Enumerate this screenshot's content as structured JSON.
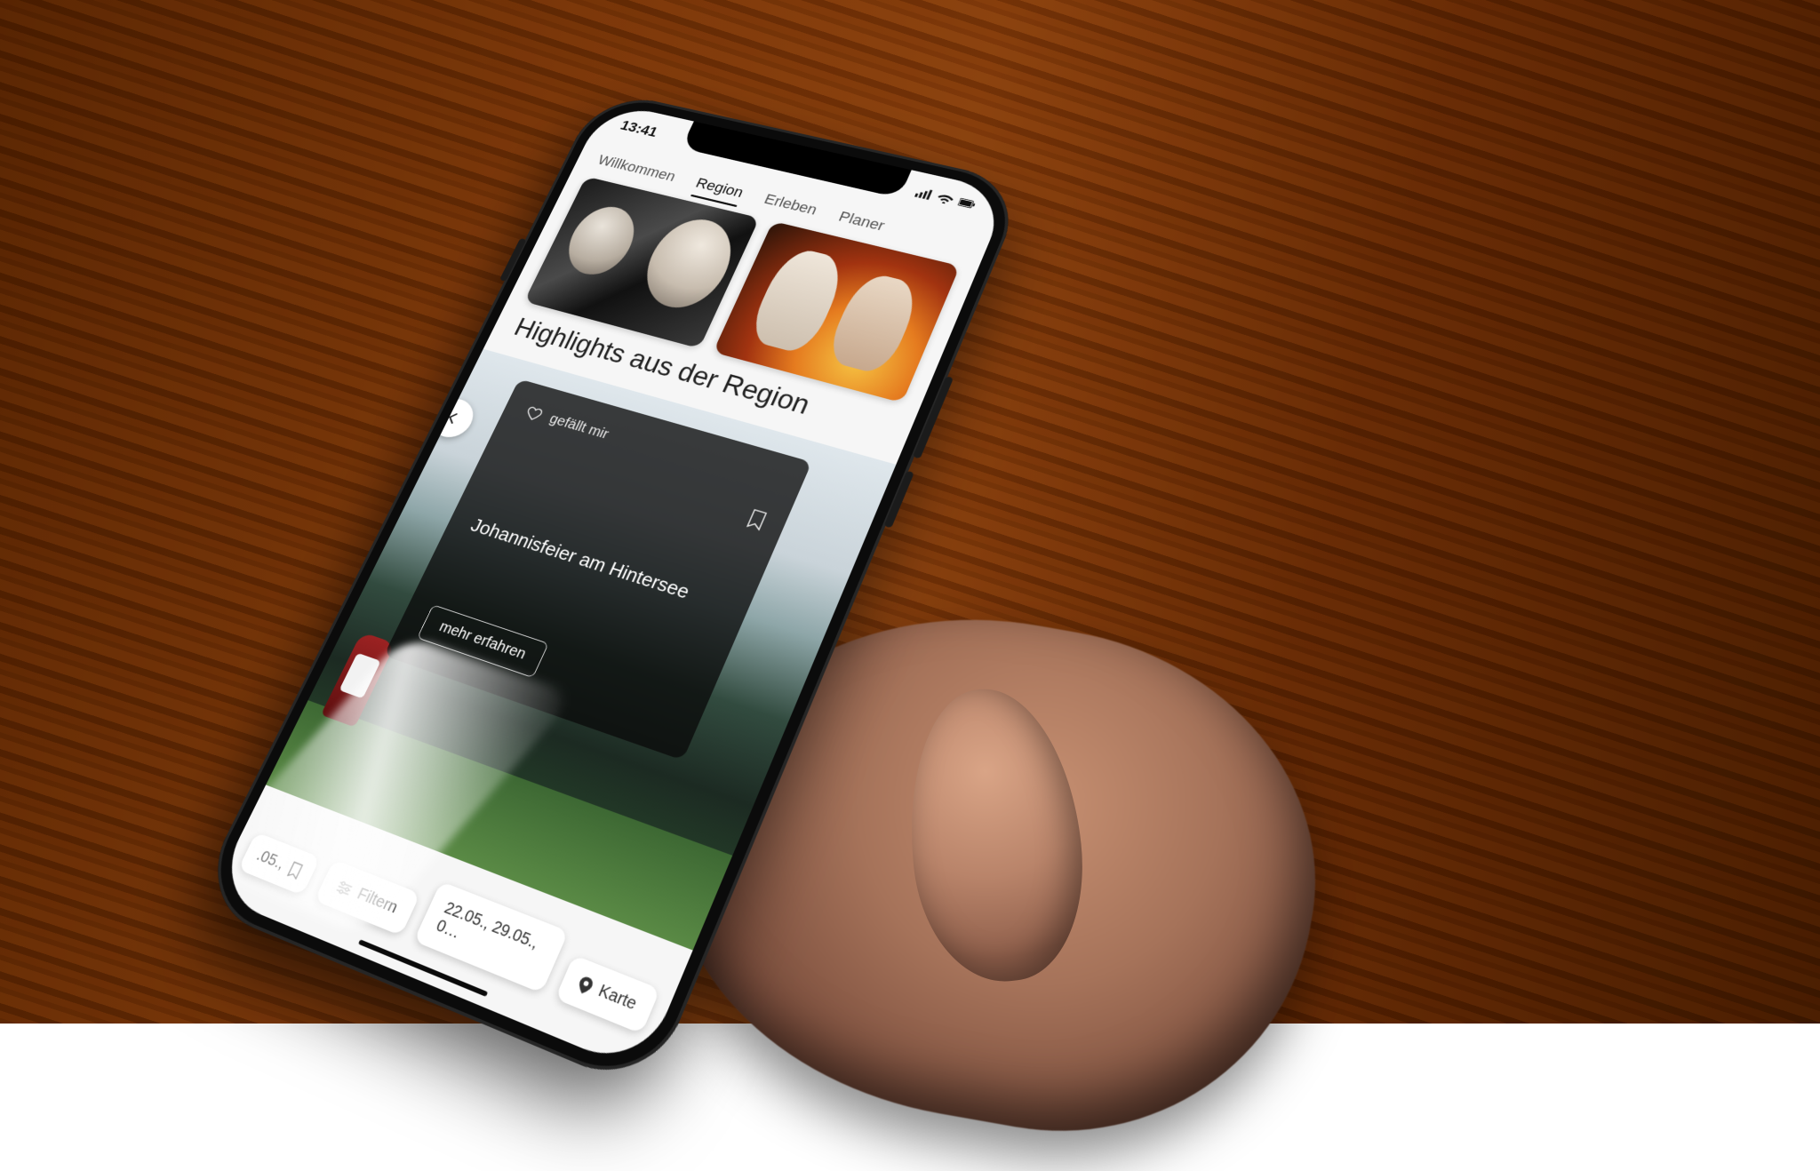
{
  "status": {
    "time": "13:41"
  },
  "tabs": {
    "items": [
      "Willkommen",
      "Region",
      "Erleben",
      "Planer"
    ],
    "active_index": 1
  },
  "section_title": "Highlights aus der Region",
  "event": {
    "like_label": "gefällt mir",
    "title": "Johannisfeier am Hintersee",
    "more_label": "mehr erfahren"
  },
  "bottom": {
    "date_fragment": ".05.,",
    "filter_label": "Filtern",
    "date_chip": "22.05., 29.05., 0…",
    "map_label": "Karte"
  }
}
